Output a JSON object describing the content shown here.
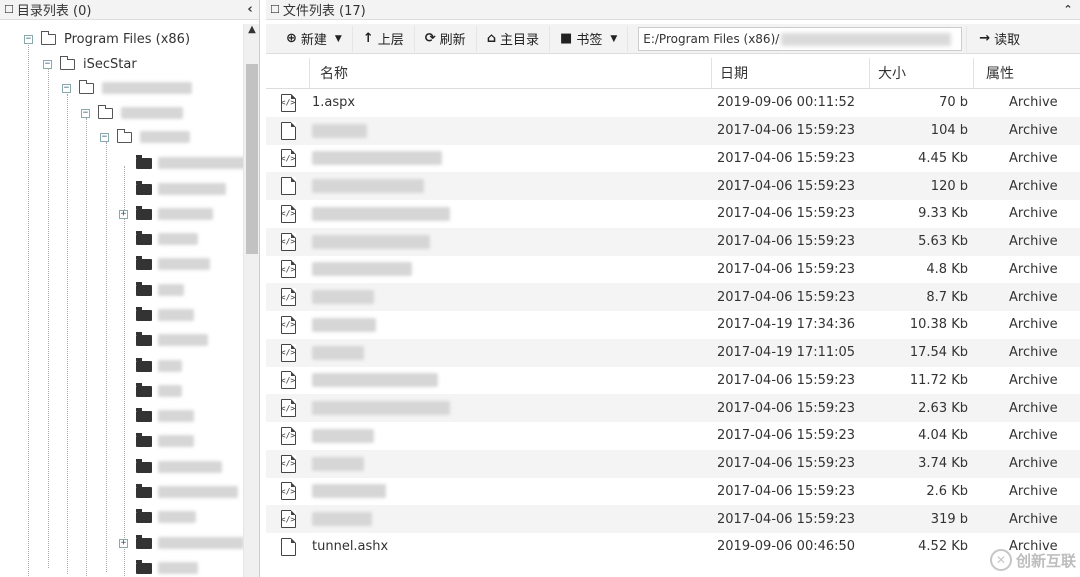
{
  "tree_panel": {
    "title": "目录列表 (0)",
    "collapse_icon": "chevron-left-icon",
    "nodes": [
      {
        "label": "Program Files (x86)",
        "expander": "−",
        "icon": "folder-outline"
      },
      {
        "label": "iSecStar",
        "expander": "−",
        "icon": "folder-outline"
      }
    ]
  },
  "file_panel": {
    "title": "文件列表 (17)",
    "collapse_icon": "chevron-up-icon"
  },
  "toolbar": {
    "new_label": "新建",
    "up_label": "上层",
    "refresh_label": "刷新",
    "home_label": "主目录",
    "bookmark_label": "书签",
    "path_value": "E:/Program Files (x86)/",
    "read_label": "读取"
  },
  "table": {
    "headers": {
      "name": "名称",
      "date": "日期",
      "size": "大小",
      "attr": "属性"
    },
    "rows": [
      {
        "icon": "code",
        "name": "1.aspx",
        "date": "2019-09-06 00:11:52",
        "size": "70 b",
        "attr": "Archive"
      },
      {
        "icon": "blank",
        "name": "",
        "date": "2017-04-06 15:59:23",
        "size": "104 b",
        "attr": "Archive"
      },
      {
        "icon": "code",
        "name": "",
        "date": "2017-04-06 15:59:23",
        "size": "4.45 Kb",
        "attr": "Archive"
      },
      {
        "icon": "blank",
        "name": "",
        "date": "2017-04-06 15:59:23",
        "size": "120 b",
        "attr": "Archive"
      },
      {
        "icon": "code",
        "name": "",
        "date": "2017-04-06 15:59:23",
        "size": "9.33 Kb",
        "attr": "Archive"
      },
      {
        "icon": "code",
        "name": "",
        "date": "2017-04-06 15:59:23",
        "size": "5.63 Kb",
        "attr": "Archive"
      },
      {
        "icon": "code",
        "name": "",
        "date": "2017-04-06 15:59:23",
        "size": "4.8 Kb",
        "attr": "Archive"
      },
      {
        "icon": "code",
        "name": "",
        "date": "2017-04-06 15:59:23",
        "size": "8.7 Kb",
        "attr": "Archive"
      },
      {
        "icon": "code",
        "name": "",
        "date": "2017-04-19 17:34:36",
        "size": "10.38 Kb",
        "attr": "Archive"
      },
      {
        "icon": "code",
        "name": "",
        "date": "2017-04-19 17:11:05",
        "size": "17.54 Kb",
        "attr": "Archive"
      },
      {
        "icon": "code",
        "name": "",
        "date": "2017-04-06 15:59:23",
        "size": "11.72 Kb",
        "attr": "Archive"
      },
      {
        "icon": "code",
        "name": "",
        "date": "2017-04-06 15:59:23",
        "size": "2.63 Kb",
        "attr": "Archive"
      },
      {
        "icon": "code",
        "name": "",
        "date": "2017-04-06 15:59:23",
        "size": "4.04 Kb",
        "attr": "Archive"
      },
      {
        "icon": "code",
        "name": "",
        "date": "2017-04-06 15:59:23",
        "size": "3.74 Kb",
        "attr": "Archive"
      },
      {
        "icon": "code",
        "name": "",
        "date": "2017-04-06 15:59:23",
        "size": "2.6 Kb",
        "attr": "Archive"
      },
      {
        "icon": "code",
        "name": "",
        "date": "2017-04-06 15:59:23",
        "size": "319 b",
        "attr": "Archive"
      },
      {
        "icon": "blank",
        "name": "tunnel.ashx",
        "date": "2019-09-06 00:46:50",
        "size": "4.52 Kb",
        "attr": "Archive"
      }
    ]
  },
  "watermark": {
    "text": "创新互联",
    "icon": "logo-icon"
  },
  "colors": {
    "header_bg": "#f3f3f3",
    "alt_row": "#f4f4f4",
    "border": "#dddddd"
  }
}
